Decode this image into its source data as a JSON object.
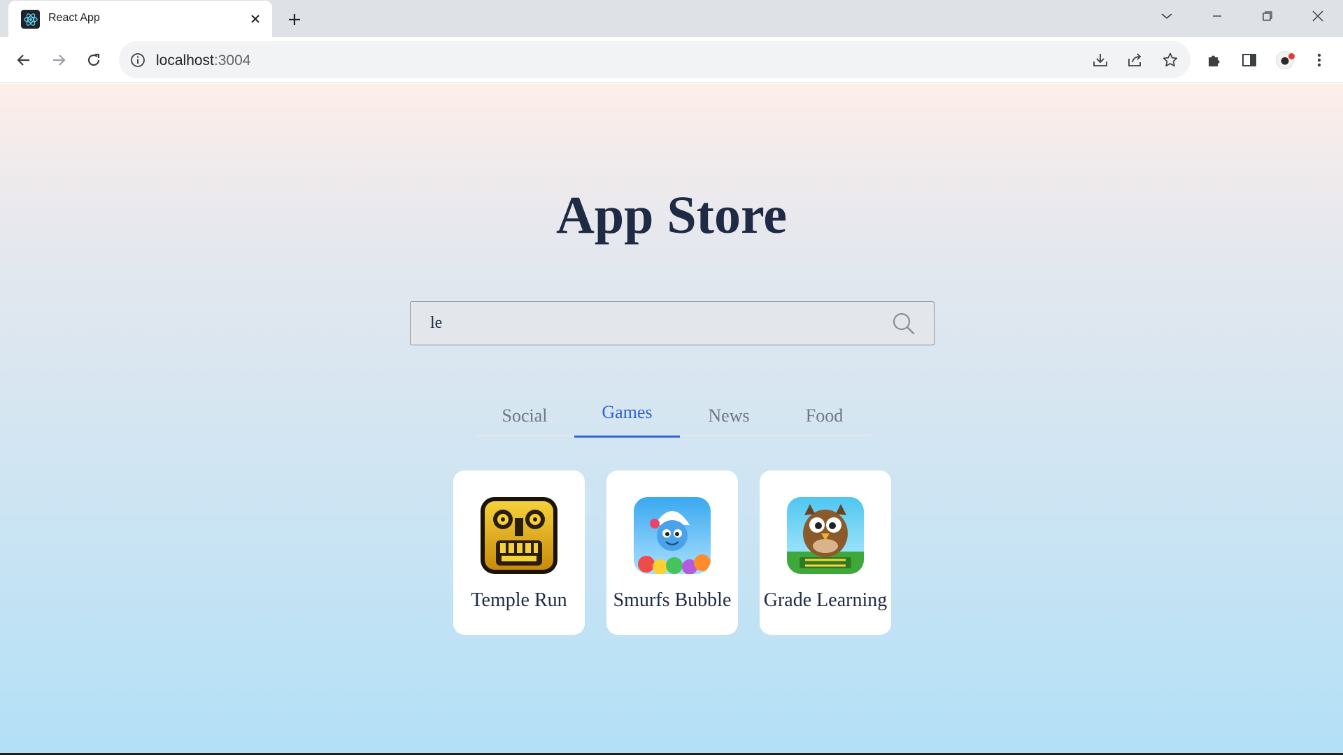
{
  "browser": {
    "tab_title": "React App",
    "url_host": "localhost",
    "url_port": ":3004"
  },
  "page": {
    "title": "App Store",
    "search": {
      "value": "le",
      "placeholder": ""
    },
    "tabs": [
      {
        "label": "Social",
        "active": false
      },
      {
        "label": "Games",
        "active": true
      },
      {
        "label": "News",
        "active": false
      },
      {
        "label": "Food",
        "active": false
      }
    ],
    "apps": [
      {
        "name": "Temple Run",
        "icon": "temple-run-icon"
      },
      {
        "name": "Smurfs Bubble",
        "icon": "smurfs-bubble-icon"
      },
      {
        "name": "Grade Learning",
        "icon": "grade-learning-icon"
      }
    ]
  },
  "colors": {
    "accent": "#2f64d6",
    "title": "#1f2a44",
    "gradient_top": "#fdeee9",
    "gradient_bottom": "#b3e0f7"
  }
}
